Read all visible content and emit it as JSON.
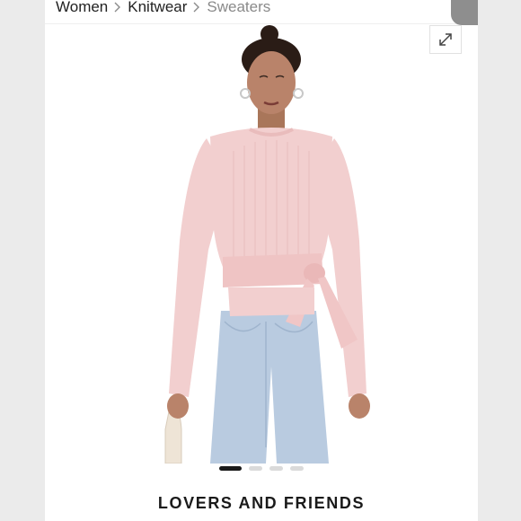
{
  "breadcrumb": {
    "items": [
      {
        "label": "Women"
      },
      {
        "label": "Knitwear"
      },
      {
        "label": "Sweaters"
      }
    ],
    "separator": ">"
  },
  "gallery": {
    "image_alt": "Model wearing light pink ribbed knit sweater with wrap tie waist and light wash jeans",
    "active_index": 1,
    "total": 4,
    "expand_icon": "expand-arrows-icon"
  },
  "product": {
    "brand": "LOVERS AND FRIENDS"
  },
  "colors": {
    "sweater": "#f2cfcf",
    "jeans": "#b9cbe0",
    "active_dot": "#1a1a1a",
    "inactive_dot": "#dadada"
  }
}
